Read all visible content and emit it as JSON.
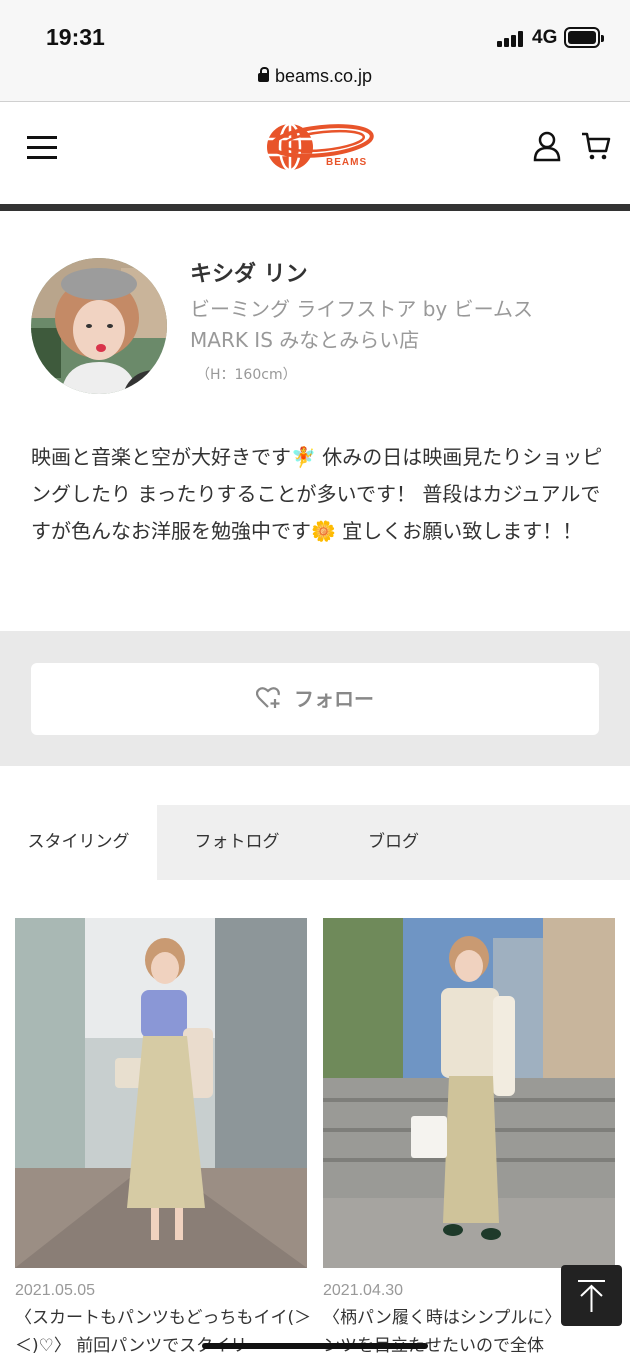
{
  "status_bar": {
    "time": "19:31",
    "network": "4G",
    "url": "beams.co.jp"
  },
  "header": {
    "logo_text": "BEAMS",
    "brand_color": "#e8542a"
  },
  "profile": {
    "name": "キシダ リン",
    "store": "ビーミング ライフストア by ビームス MARK IS みなとみらい店",
    "height": "（H：160cm）",
    "bio": "映画と音楽と空が大好きです🧚 休みの日は映画見たりショッピングしたり まったりすることが多いです！ 普段はカジュアルですが色んなお洋服を勉強中です🌼 宜しくお願い致します！！"
  },
  "follow": {
    "label": "フォロー"
  },
  "tabs": [
    {
      "label": "スタイリング",
      "active": true
    },
    {
      "label": "フォトログ",
      "active": false
    },
    {
      "label": "ブログ",
      "active": false
    }
  ],
  "posts": [
    {
      "date": "2021.05.05",
      "caption": "〈スカートもパンツもどっちもイイ(＞＜)♡〉 前回パンツでスタイリ"
    },
    {
      "date": "2021.04.30",
      "caption": "〈柄パン履く時はシンプルに〉 柄のパンツを目立たせたいので全体"
    }
  ]
}
